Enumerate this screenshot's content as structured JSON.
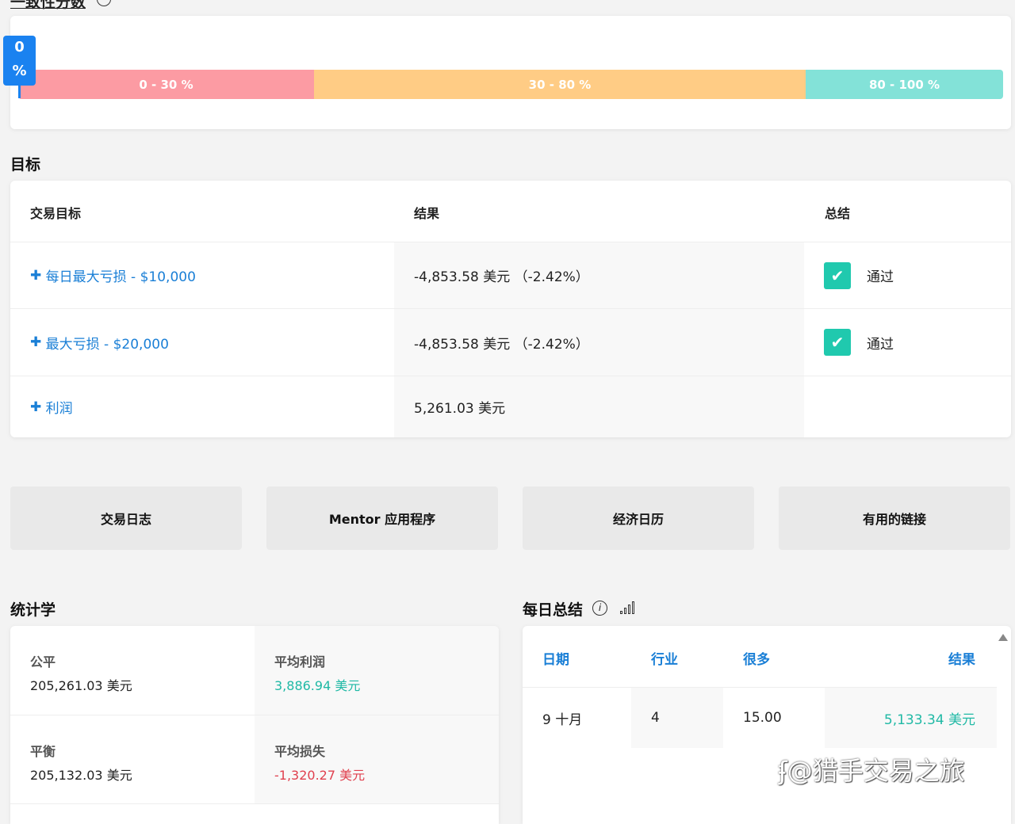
{
  "consistency": {
    "title": "一致性分数",
    "marker_value": "0",
    "marker_unit": "%",
    "value_percent": 0,
    "ranges": [
      {
        "label": "0 - 30 %",
        "color": "#fc9ba3"
      },
      {
        "label": "30 - 80 %",
        "color": "#ffcc85"
      },
      {
        "label": "80 - 100 %",
        "color": "#83e2d8"
      }
    ]
  },
  "goals": {
    "title": "目标",
    "headers": [
      "交易目标",
      "结果",
      "总结"
    ],
    "rows": [
      {
        "goal": "每日最大亏损 - $10,000",
        "result": "-4,853.58 美元 （-2.42%）",
        "summary": "通过"
      },
      {
        "goal": "最大亏损 - $20,000",
        "result": "-4,853.58 美元 （-2.42%）",
        "summary": "通过"
      },
      {
        "goal": "利润",
        "result": "5,261.03 美元",
        "summary": ""
      }
    ]
  },
  "buttons": [
    "交易日志",
    "Mentor 应用程序",
    "经济日历",
    "有用的链接"
  ],
  "stats": {
    "title": "统计学",
    "items": [
      {
        "label": "公平",
        "value": "205,261.03 美元",
        "color": "#222"
      },
      {
        "label": "平均利润",
        "value": "3,886.94 美元",
        "color": "#20b9a5"
      },
      {
        "label": "平衡",
        "value": "205,132.03 美元",
        "color": "#222"
      },
      {
        "label": "平均损失",
        "value": "-1,320.27 美元",
        "color": "#e0404e"
      }
    ]
  },
  "daily": {
    "title": "每日总结",
    "headers": [
      "日期",
      "行业",
      "很多",
      "结果"
    ],
    "rows": [
      {
        "date": "9 十月",
        "trades": "4",
        "lots": "15.00",
        "result": "5,133.34 美元"
      }
    ]
  },
  "watermark": "@猎手交易之旅"
}
